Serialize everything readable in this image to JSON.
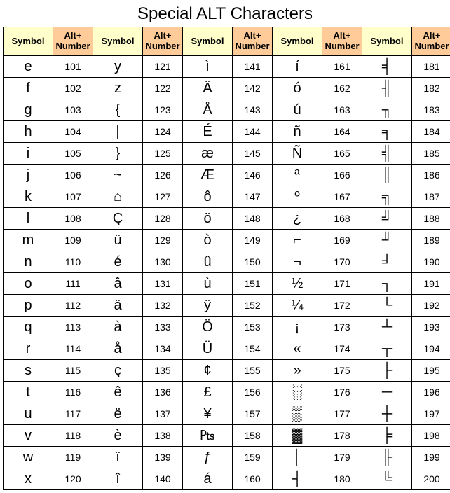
{
  "title": "Special ALT Characters",
  "headers": {
    "symbol": "Symbol",
    "alt": "Alt+\nNumber"
  },
  "columns": [
    [
      {
        "s": "e",
        "n": "101"
      },
      {
        "s": "f",
        "n": "102"
      },
      {
        "s": "g",
        "n": "103"
      },
      {
        "s": "h",
        "n": "104"
      },
      {
        "s": "i",
        "n": "105"
      },
      {
        "s": "j",
        "n": "106"
      },
      {
        "s": "k",
        "n": "107"
      },
      {
        "s": "l",
        "n": "108"
      },
      {
        "s": "m",
        "n": "109"
      },
      {
        "s": "n",
        "n": "110"
      },
      {
        "s": "o",
        "n": "111"
      },
      {
        "s": "p",
        "n": "112"
      },
      {
        "s": "q",
        "n": "113"
      },
      {
        "s": "r",
        "n": "114"
      },
      {
        "s": "s",
        "n": "115"
      },
      {
        "s": "t",
        "n": "116"
      },
      {
        "s": "u",
        "n": "117"
      },
      {
        "s": "v",
        "n": "118"
      },
      {
        "s": "w",
        "n": "119"
      },
      {
        "s": "x",
        "n": "120"
      }
    ],
    [
      {
        "s": "y",
        "n": "121"
      },
      {
        "s": "z",
        "n": "122"
      },
      {
        "s": "{",
        "n": "123"
      },
      {
        "s": "|",
        "n": "124"
      },
      {
        "s": "}",
        "n": "125"
      },
      {
        "s": "~",
        "n": "126"
      },
      {
        "s": "⌂",
        "n": "127"
      },
      {
        "s": "Ç",
        "n": "128"
      },
      {
        "s": "ü",
        "n": "129"
      },
      {
        "s": "é",
        "n": "130"
      },
      {
        "s": "â",
        "n": "131"
      },
      {
        "s": "ä",
        "n": "132"
      },
      {
        "s": "à",
        "n": "133"
      },
      {
        "s": "å",
        "n": "134"
      },
      {
        "s": "ç",
        "n": "135"
      },
      {
        "s": "ê",
        "n": "136"
      },
      {
        "s": "ë",
        "n": "137"
      },
      {
        "s": "è",
        "n": "138"
      },
      {
        "s": "ï",
        "n": "139"
      },
      {
        "s": "î",
        "n": "140"
      }
    ],
    [
      {
        "s": "ì",
        "n": "141"
      },
      {
        "s": "Ä",
        "n": "142"
      },
      {
        "s": "Å",
        "n": "143"
      },
      {
        "s": "É",
        "n": "144"
      },
      {
        "s": "æ",
        "n": "145"
      },
      {
        "s": "Æ",
        "n": "146"
      },
      {
        "s": "ô",
        "n": "147"
      },
      {
        "s": "ö",
        "n": "148"
      },
      {
        "s": "ò",
        "n": "149"
      },
      {
        "s": "û",
        "n": "150"
      },
      {
        "s": "ù",
        "n": "151"
      },
      {
        "s": "ÿ",
        "n": "152"
      },
      {
        "s": "Ö",
        "n": "153"
      },
      {
        "s": "Ü",
        "n": "154"
      },
      {
        "s": "¢",
        "n": "155"
      },
      {
        "s": "£",
        "n": "156"
      },
      {
        "s": "¥",
        "n": "157"
      },
      {
        "s": "₧",
        "n": "158"
      },
      {
        "s": "ƒ",
        "n": "159"
      },
      {
        "s": "á",
        "n": "160"
      }
    ],
    [
      {
        "s": "í",
        "n": "161"
      },
      {
        "s": "ó",
        "n": "162"
      },
      {
        "s": "ú",
        "n": "163"
      },
      {
        "s": "ñ",
        "n": "164"
      },
      {
        "s": "Ñ",
        "n": "165"
      },
      {
        "s": "ª",
        "n": "166"
      },
      {
        "s": "º",
        "n": "167"
      },
      {
        "s": "¿",
        "n": "168"
      },
      {
        "s": "⌐",
        "n": "169"
      },
      {
        "s": "¬",
        "n": "170"
      },
      {
        "s": "½",
        "n": "171"
      },
      {
        "s": "¼",
        "n": "172"
      },
      {
        "s": "¡",
        "n": "173"
      },
      {
        "s": "«",
        "n": "174"
      },
      {
        "s": "»",
        "n": "175"
      },
      {
        "s": "░",
        "n": "176"
      },
      {
        "s": "▒",
        "n": "177"
      },
      {
        "s": "▓",
        "n": "178"
      },
      {
        "s": "│",
        "n": "179"
      },
      {
        "s": "┤",
        "n": "180"
      }
    ],
    [
      {
        "s": "╡",
        "n": "181"
      },
      {
        "s": "╢",
        "n": "182"
      },
      {
        "s": "╖",
        "n": "183"
      },
      {
        "s": "╕",
        "n": "184"
      },
      {
        "s": "╣",
        "n": "185"
      },
      {
        "s": "║",
        "n": "186"
      },
      {
        "s": "╗",
        "n": "187"
      },
      {
        "s": "╝",
        "n": "188"
      },
      {
        "s": "╜",
        "n": "189"
      },
      {
        "s": "╛",
        "n": "190"
      },
      {
        "s": "┐",
        "n": "191"
      },
      {
        "s": "└",
        "n": "192"
      },
      {
        "s": "┴",
        "n": "193"
      },
      {
        "s": "┬",
        "n": "194"
      },
      {
        "s": "├",
        "n": "195"
      },
      {
        "s": "─",
        "n": "196"
      },
      {
        "s": "┼",
        "n": "197"
      },
      {
        "s": "╞",
        "n": "198"
      },
      {
        "s": "╟",
        "n": "199"
      },
      {
        "s": "╚",
        "n": "200"
      }
    ]
  ]
}
